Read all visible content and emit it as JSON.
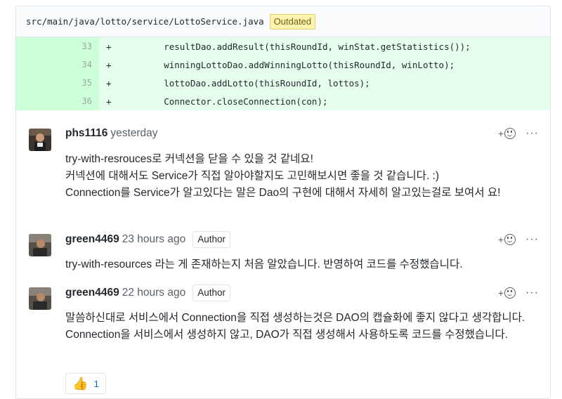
{
  "file": {
    "path": "src/main/java/lotto/service/LottoService.java",
    "badge": "Outdated"
  },
  "diff_lines": [
    {
      "num": "33",
      "sign": "+",
      "code": "        resultDao.addResult(thisRoundId, winStat.getStatistics());"
    },
    {
      "num": "34",
      "sign": "+",
      "code": "        winningLottoDao.addWinningLotto(thisRoundId, winLotto);"
    },
    {
      "num": "35",
      "sign": "+",
      "code": "        lottoDao.addLotto(thisRoundId, lottos);"
    },
    {
      "num": "36",
      "sign": "+",
      "code": "        Connector.closeConnection(con);"
    }
  ],
  "comments": [
    {
      "author": "phs1116",
      "time": "yesterday",
      "paragraphs": [
        "try-with-resrouces로 커넥션을 닫을 수 있을 것 같네요!",
        "커넥션에 대해서도 Service가 직접 알아야할지도 고민해보시면 좋을 것 같습니다. :)",
        "Connection를 Service가 알고있다는 말은 Dao의 구현에 대해서 자세히 알고있는걸로 보여서 요!"
      ]
    },
    {
      "author": "green4469",
      "time": "23 hours ago",
      "badge": "Author",
      "paragraphs": [
        "try-with-resources 라는 게 존재하는지 처음 알았습니다. 반영하여 코드를 수정했습니다."
      ]
    },
    {
      "author": "green4469",
      "time": "22 hours ago",
      "badge": "Author",
      "paragraphs": [
        "말씀하신대로 서비스에서 Connection을 직접 생성하는것은 DAO의 캡슐화에 좋지 않다고 생각합니다. Connection을 서비스에서 생성하지 않고, DAO가 직접 생성해서 사용하도록 코드를 수정했습니다."
      ],
      "reaction": {
        "emoji": "👍",
        "count": "1"
      }
    }
  ],
  "actions": {
    "react_plus": "+",
    "more": "···"
  }
}
